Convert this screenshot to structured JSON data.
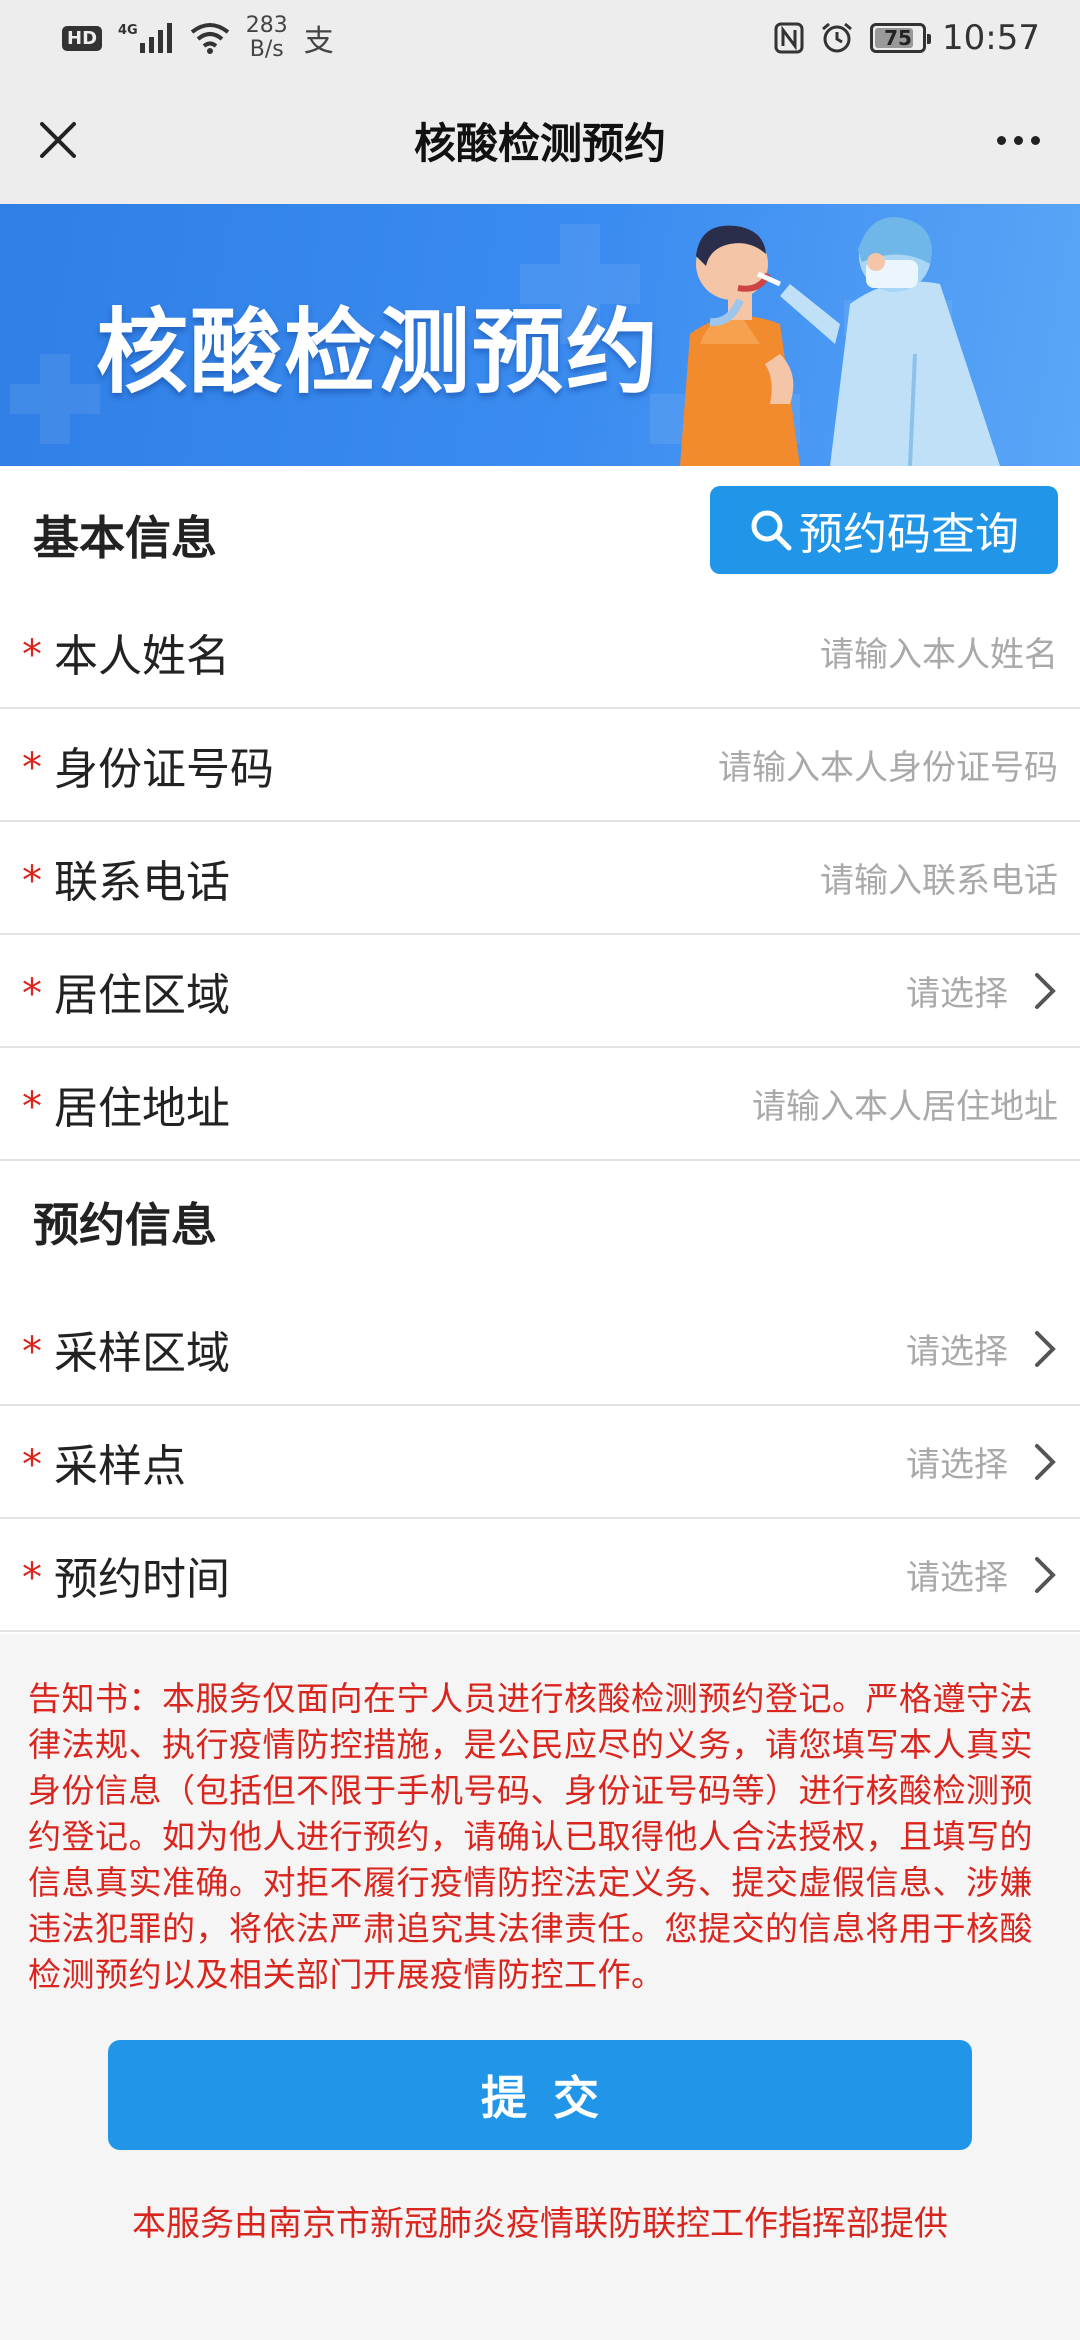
{
  "status_bar": {
    "hd": "HD",
    "signal": "4G",
    "speed_value": "283",
    "speed_unit": "B/s",
    "alipay_glyph": "支",
    "battery": "75",
    "time": "10:57"
  },
  "nav": {
    "title": "核酸检测预约",
    "close_icon": "close-icon",
    "more_icon": "more-icon"
  },
  "banner": {
    "title": "核酸检测预约"
  },
  "basic_section": {
    "title": "基本信息",
    "query_button": "预约码查询"
  },
  "basic_fields": [
    {
      "label": "本人姓名",
      "placeholder": "请输入本人姓名",
      "type": "input"
    },
    {
      "label": "身份证号码",
      "placeholder": "请输入本人身份证号码",
      "type": "input"
    },
    {
      "label": "联系电话",
      "placeholder": "请输入联系电话",
      "type": "input"
    },
    {
      "label": "居住区域",
      "placeholder": "请选择",
      "type": "select"
    },
    {
      "label": "居住地址",
      "placeholder": "请输入本人居住地址",
      "type": "input"
    }
  ],
  "appointment_section": {
    "title": "预约信息"
  },
  "appointment_fields": [
    {
      "label": "采样区域",
      "placeholder": "请选择",
      "type": "select"
    },
    {
      "label": "采样点",
      "placeholder": "请选择",
      "type": "select"
    },
    {
      "label": "预约时间",
      "placeholder": "请选择",
      "type": "select"
    }
  ],
  "required_mark": "*",
  "notice": "告知书：本服务仅面向在宁人员进行核酸检测预约登记。严格遵守法律法规、执行疫情防控措施，是公民应尽的义务，请您填写本人真实身份信息（包括但不限于手机号码、身份证号码等）进行核酸检测预约登记。如为他人进行预约，请确认已取得他人合法授权，且填写的信息真实准确。对拒不履行疫情防控法定义务、提交虚假信息、涉嫌违法犯罪的，将依法严肃追究其法律责任。您提交的信息将用于核酸检测预约以及相关部门开展疫情防控工作。",
  "submit_button": "提交",
  "footer": "本服务由南京市新冠肺炎疫情联防联控工作指挥部提供",
  "colors": {
    "primary": "#2196e8",
    "required": "#d9251d",
    "placeholder": "#a9a9a9",
    "banner": "#2f7fe6"
  }
}
